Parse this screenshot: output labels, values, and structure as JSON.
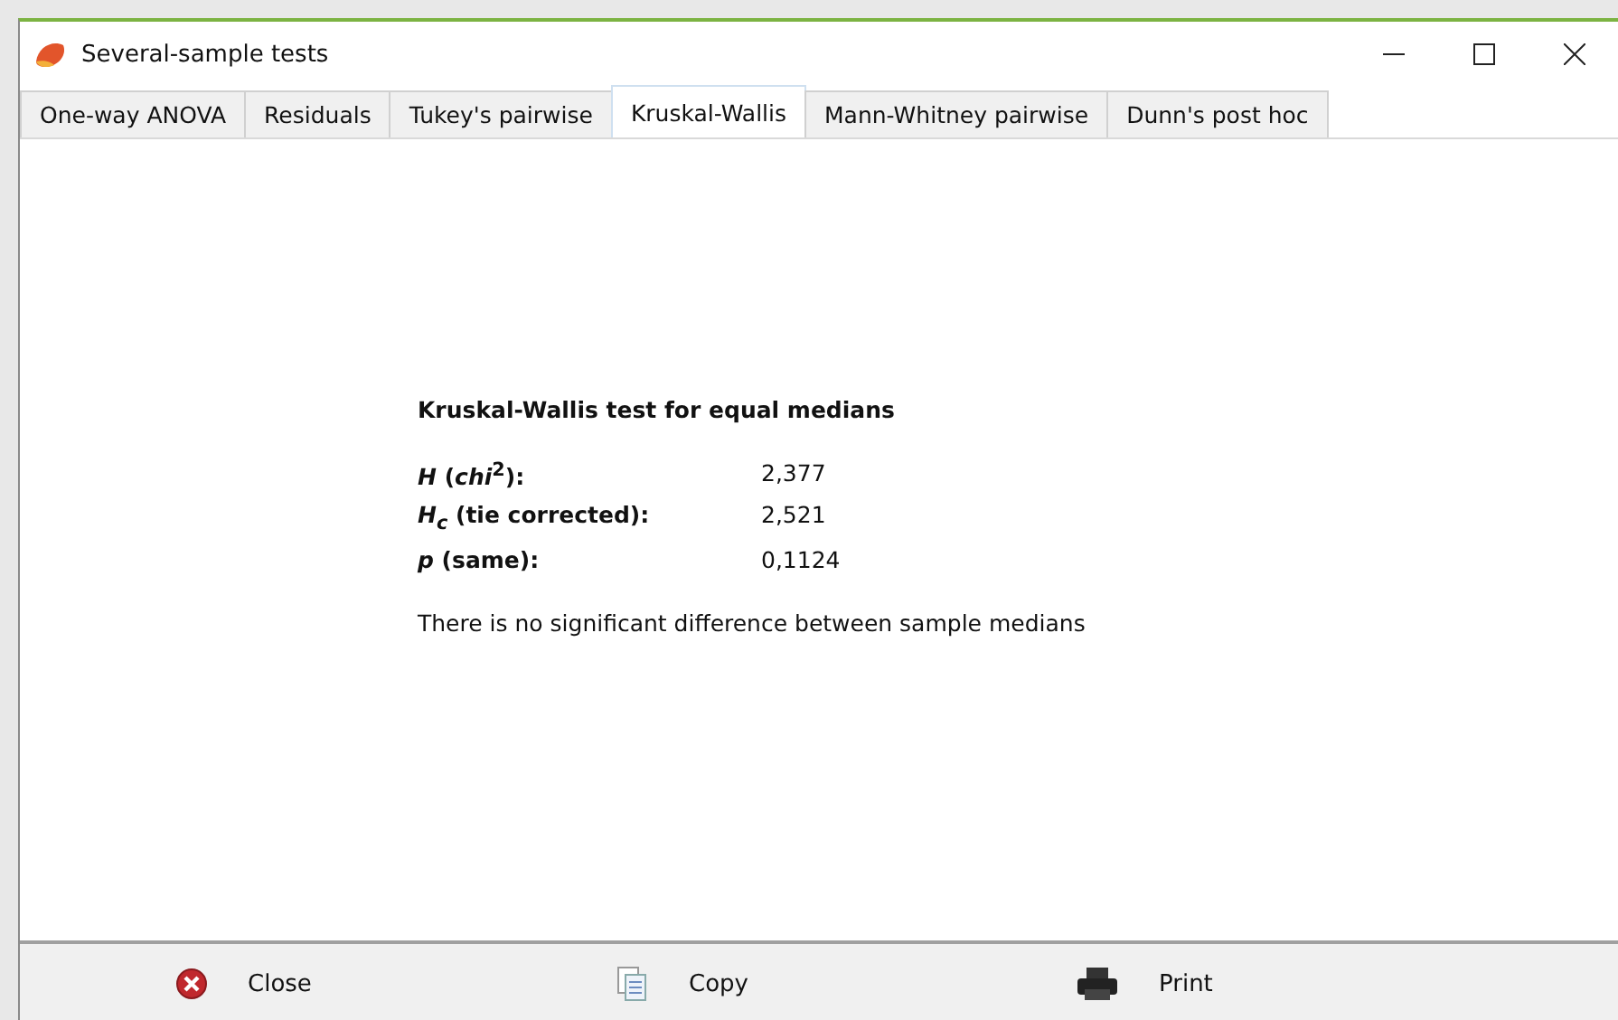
{
  "window": {
    "title": "Several-sample tests"
  },
  "tabs": [
    {
      "label": "One-way ANOVA",
      "selected": false
    },
    {
      "label": "Residuals",
      "selected": false
    },
    {
      "label": "Tukey's pairwise",
      "selected": false
    },
    {
      "label": "Kruskal-Wallis",
      "selected": true
    },
    {
      "label": "Mann-Whitney pairwise",
      "selected": false
    },
    {
      "label": "Dunn's post hoc",
      "selected": false
    }
  ],
  "report": {
    "heading": "Kruskal-Wallis test for equal medians",
    "rows": [
      {
        "label": "*H* (*chi*$^{2}$):",
        "value": "2,377"
      },
      {
        "label": "*H*$_{c}$ (tie corrected):",
        "value": "2,521"
      },
      {
        "label": "*p* (same):",
        "value": "0,1124"
      }
    ],
    "conclusion": "There is no significant difference between sample medians"
  },
  "buttons": [
    {
      "kind": "close",
      "label": "Close"
    },
    {
      "kind": "copy",
      "label": "Copy"
    },
    {
      "kind": "print",
      "label": "Print"
    }
  ]
}
